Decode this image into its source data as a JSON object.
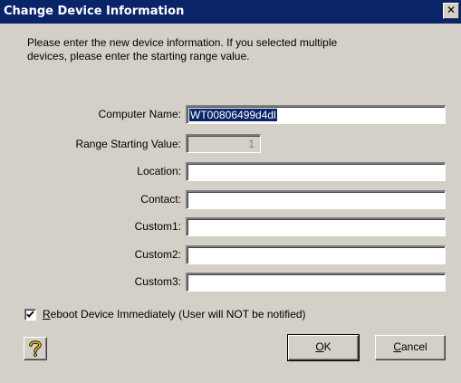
{
  "window": {
    "title": "Change Device Information",
    "close_glyph": "✕"
  },
  "instructions": {
    "line1": "Please enter the new device information.  If you selected multiple",
    "line2": "devices, please enter the starting range value."
  },
  "fields": {
    "computer_name": {
      "label": "Computer Name:",
      "value": "WT00806499d4dl",
      "selected": true
    },
    "range_start": {
      "label": "Range Starting Value:",
      "value": "1",
      "disabled": true
    },
    "location": {
      "label": "Location:",
      "value": ""
    },
    "contact": {
      "label": "Contact:",
      "value": ""
    },
    "custom1": {
      "label": "Custom1:",
      "value": ""
    },
    "custom2": {
      "label": "Custom2:",
      "value": ""
    },
    "custom3": {
      "label": "Custom3:",
      "value": ""
    }
  },
  "reboot": {
    "checked": true,
    "mnemonic": "R",
    "label_rest": "eboot Device Immediately (User will NOT be notified)"
  },
  "buttons": {
    "help_icon": "help-question-icon",
    "ok_mnemonic": "O",
    "ok_rest": "K",
    "cancel_mnemonic": "C",
    "cancel_rest": "ancel"
  },
  "colors": {
    "titlebar": "#0a246a",
    "dialog_face": "#d4d0c8",
    "selection": "#0a246a",
    "help_icon": "#c8a000"
  }
}
